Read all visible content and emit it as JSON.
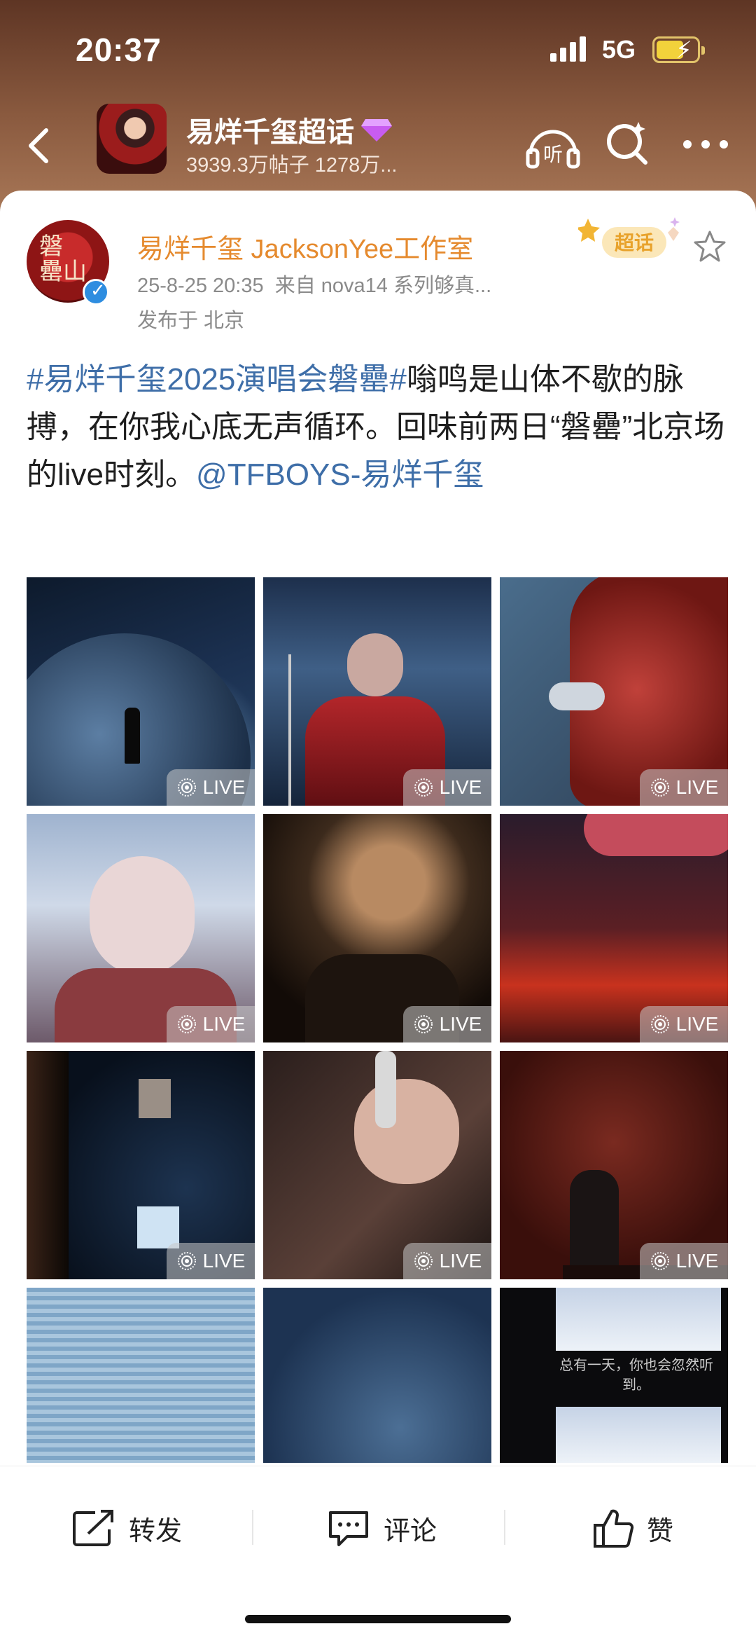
{
  "status": {
    "time": "20:37",
    "network": "5G"
  },
  "topic": {
    "title": "易烊千玺超话",
    "stats": "3939.3万帖子 1278万..."
  },
  "post": {
    "author": "易烊千玺 JacksonYee工作室",
    "date": "25-8-25 20:35",
    "source": "来自 nova14 系列够真...",
    "location": "发布于 北京",
    "hashtag": "#易烊千玺2025演唱会磐罍#",
    "body": "嗡鸣是山体不歇的脉搏，在你我心底无声循环。回味前两日“磐罍”北京场的live时刻。",
    "mention": "@TFBOYS-易烊千玺",
    "badge": "超话",
    "live_label": "LIVE",
    "tiles": [
      {
        "caption": ""
      },
      {
        "caption": ""
      },
      {
        "caption": ""
      },
      {
        "caption": ""
      },
      {
        "caption": ""
      },
      {
        "caption": ""
      },
      {
        "caption": ""
      },
      {
        "caption": ""
      },
      {
        "caption": ""
      },
      {
        "caption": ""
      },
      {
        "caption": ""
      },
      {
        "caption": "总有一天，你也会忽然听到。"
      }
    ]
  },
  "actions": {
    "repost": "转发",
    "comment": "评论",
    "like": "赞"
  },
  "colors": {
    "author": "#e58a2e",
    "link": "#3e6ea8",
    "header": "#8a5a3f"
  }
}
